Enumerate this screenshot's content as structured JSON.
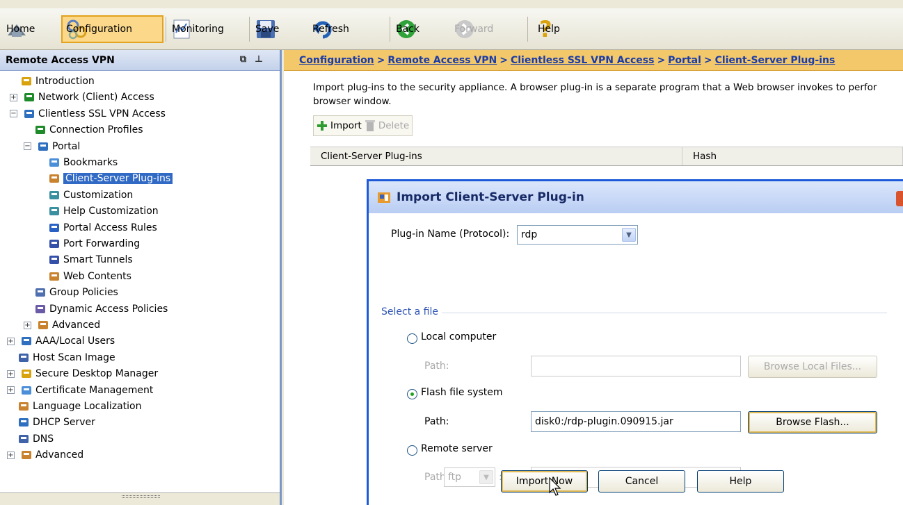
{
  "toolbar": {
    "home": "Home",
    "configuration": "Configuration",
    "monitoring": "Monitoring",
    "save": "Save",
    "refresh": "Refresh",
    "back": "Back",
    "forward": "Forward",
    "help": "Help"
  },
  "left_pane": {
    "title": "Remote Access VPN",
    "tree": [
      {
        "label": "Introduction",
        "icon": "help-icon"
      },
      {
        "label": "Network (Client) Access",
        "icon": "network-icon"
      },
      {
        "label": "Clientless SSL VPN Access",
        "icon": "vpn-icon"
      },
      {
        "label": "Connection Profiles",
        "icon": "profile-icon"
      },
      {
        "label": "Portal",
        "icon": "portal-icon"
      },
      {
        "label": "Bookmarks",
        "icon": "bookmark-icon"
      },
      {
        "label": "Client-Server Plug-ins",
        "icon": "plugin-icon",
        "selected": true
      },
      {
        "label": "Customization",
        "icon": "customization-icon"
      },
      {
        "label": "Help Customization",
        "icon": "help-customization-icon"
      },
      {
        "label": "Portal Access Rules",
        "icon": "rules-icon"
      },
      {
        "label": "Port Forwarding",
        "icon": "port-forwarding-icon"
      },
      {
        "label": "Smart Tunnels",
        "icon": "tunnel-icon"
      },
      {
        "label": "Web Contents",
        "icon": "web-contents-icon"
      },
      {
        "label": "Group Policies",
        "icon": "group-policy-icon"
      },
      {
        "label": "Dynamic Access Policies",
        "icon": "dynamic-policy-icon"
      },
      {
        "label": "Advanced",
        "icon": "advanced-icon"
      },
      {
        "label": "AAA/Local Users",
        "icon": "lock-icon"
      },
      {
        "label": "Host Scan Image",
        "icon": "host-scan-icon"
      },
      {
        "label": "Secure Desktop Manager",
        "icon": "secure-desktop-icon"
      },
      {
        "label": "Certificate Management",
        "icon": "certificate-icon"
      },
      {
        "label": "Language Localization",
        "icon": "language-icon"
      },
      {
        "label": "DHCP Server",
        "icon": "dhcp-icon"
      },
      {
        "label": "DNS",
        "icon": "dns-icon"
      },
      {
        "label": "Advanced",
        "icon": "advanced-icon"
      }
    ]
  },
  "breadcrumb": {
    "items": [
      "Configuration",
      "Remote Access VPN",
      "Clientless SSL VPN Access",
      "Portal",
      "Client-Server Plug-ins"
    ],
    "separator": ">"
  },
  "main": {
    "description_line1": "Import plug-ins to the security appliance. A browser plug-in is a separate program that a Web browser invokes to perfor",
    "description_line2": "browser window.",
    "import_label": "Import",
    "delete_label": "Delete",
    "columns": [
      "Client-Server Plug-ins",
      "Hash"
    ]
  },
  "dialog": {
    "title": "Import Client-Server Plug-in",
    "plugin_name_label": "Plug-in Name (Protocol):",
    "plugin_name_value": "rdp",
    "select_file_legend": "Select a file",
    "local_computer_label": "Local computer",
    "local_path_label": "Path:",
    "local_path_value": "",
    "browse_local_label": "Browse Local Files...",
    "flash_label": "Flash file system",
    "flash_path_label": "Path:",
    "flash_path_value": "disk0:/rdp-plugin.090915.jar",
    "browse_flash_label": "Browse Flash...",
    "remote_label": "Remote server",
    "remote_path_label": "Path",
    "remote_protocol_value": "ftp",
    "remote_separator": "://",
    "remote_path_value": "",
    "import_now_label": "Import Now",
    "cancel_label": "Cancel",
    "help_label": "Help",
    "selected_source": "Flash file system"
  },
  "colors": {
    "breadcrumb_bg": "#f3c86b",
    "selection": "#316ac5",
    "dialog_border": "#1d5ad8"
  }
}
